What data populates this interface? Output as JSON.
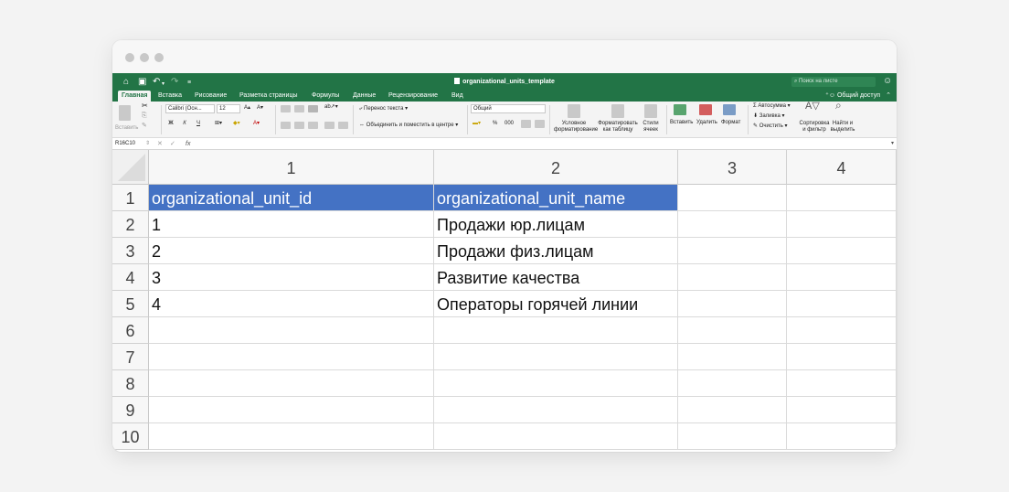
{
  "document": {
    "title": "organizational_units_template"
  },
  "search": {
    "placeholder": "Поиск на листе"
  },
  "tabs": [
    "Главная",
    "Вставка",
    "Рисование",
    "Разметка страницы",
    "Формулы",
    "Данные",
    "Рецензирование",
    "Вид"
  ],
  "share_label": "Общий доступ",
  "ribbon": {
    "paste": "Вставить",
    "font_name": "Calibri (Осн...",
    "font_size": "12",
    "bold": "Ж",
    "italic": "К",
    "underline": "Ч",
    "wrap_text": "Перенос текста",
    "merge_center": "Объединить и поместить в центре",
    "number_format": "Общий",
    "percent": "%",
    "thousands": "000",
    "cond_format_1": "Условное",
    "cond_format_2": "форматирование",
    "format_table_1": "Форматировать",
    "format_table_2": "как таблицу",
    "cell_styles_1": "Стили",
    "cell_styles_2": "ячеек",
    "insert": "Вставить",
    "delete": "Удалить",
    "format": "Формат",
    "autosum": "Автосумма",
    "fill": "Заливка",
    "clear": "Очистить",
    "sort_1": "Сортировка",
    "sort_2": "и фильтр",
    "find_1": "Найти и",
    "find_2": "выделить"
  },
  "formula_bar": {
    "name_box": "R16C10",
    "fx": "fx",
    "content": ""
  },
  "sheet": {
    "columns": [
      "1",
      "2",
      "3",
      "4"
    ],
    "rows": [
      "1",
      "2",
      "3",
      "4",
      "5",
      "6",
      "7",
      "8",
      "9",
      "10"
    ],
    "cells": [
      [
        "organizational_unit_id",
        "organizational_unit_name",
        "",
        ""
      ],
      [
        "1",
        "Продажи юр.лицам",
        "",
        ""
      ],
      [
        "2",
        "Продажи физ.лицам",
        "",
        ""
      ],
      [
        "3",
        "Развитие качества",
        "",
        ""
      ],
      [
        "4",
        "Операторы горячей линии",
        "",
        ""
      ],
      [
        "",
        "",
        "",
        ""
      ],
      [
        "",
        "",
        "",
        ""
      ],
      [
        "",
        "",
        "",
        ""
      ],
      [
        "",
        "",
        "",
        ""
      ],
      [
        "",
        "",
        "",
        ""
      ]
    ],
    "header_fill": "#4472c4"
  },
  "colors": {
    "accent": "#227446",
    "header_fill": "#4472c4"
  }
}
